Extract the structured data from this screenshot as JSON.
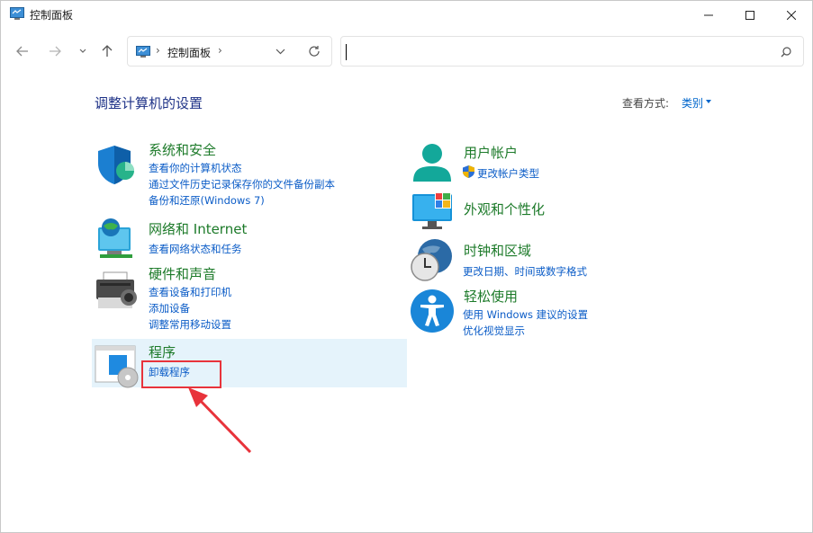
{
  "window": {
    "title": "控制面板",
    "minimize_icon": "minimize-icon",
    "maximize_icon": "maximize-icon",
    "close_icon": "close-icon"
  },
  "nav": {
    "address_path": "控制面板",
    "search_placeholder": ""
  },
  "content": {
    "heading": "调整计算机的设置",
    "view_by_label": "查看方式:",
    "view_by_value": "类别"
  },
  "categories": {
    "system": {
      "title": "系统和安全",
      "links": [
        "查看你的计算机状态",
        "通过文件历史记录保存你的文件备份副本",
        "备份和还原(Windows 7)"
      ]
    },
    "network": {
      "title": "网络和 Internet",
      "links": [
        "查看网络状态和任务"
      ]
    },
    "hardware": {
      "title": "硬件和声音",
      "links": [
        "查看设备和打印机",
        "添加设备",
        "调整常用移动设置"
      ]
    },
    "programs": {
      "title": "程序",
      "links": [
        "卸载程序"
      ]
    },
    "user": {
      "title": "用户帐户",
      "links": [
        "更改帐户类型"
      ]
    },
    "appearance": {
      "title": "外观和个性化",
      "links": []
    },
    "clock": {
      "title": "时钟和区域",
      "links": [
        "更改日期、时间或数字格式"
      ]
    },
    "ease": {
      "title": "轻松使用",
      "links": [
        "使用 Windows 建议的设置",
        "优化视觉显示"
      ]
    }
  },
  "colors": {
    "category_title": "#1c7a29",
    "link": "#0b5cc7",
    "heading": "#1e3287",
    "highlight_bg": "#e5f3fb",
    "annotation_red": "#e8333b"
  }
}
